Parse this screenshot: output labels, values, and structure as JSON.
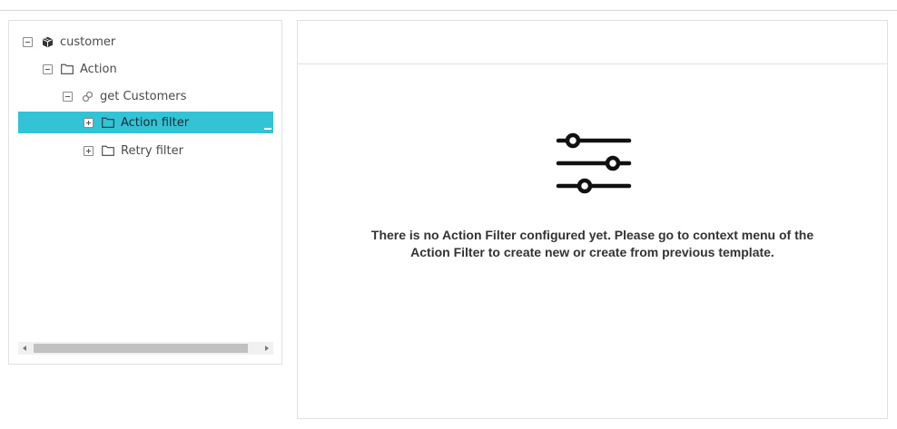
{
  "tree": {
    "nodes": [
      {
        "label": "customer",
        "icon": "cube-icon",
        "expanded": true,
        "level": 0
      },
      {
        "label": "Action",
        "icon": "folder-icon",
        "expanded": true,
        "level": 1
      },
      {
        "label": "get Customers",
        "icon": "link-icon",
        "expanded": true,
        "level": 2
      },
      {
        "label": "Action filter",
        "icon": "folder-icon",
        "expanded": false,
        "level": 3,
        "selected": true
      },
      {
        "label": "Retry filter",
        "icon": "folder-icon",
        "expanded": false,
        "level": 3
      }
    ],
    "selected_color": "#33c3d6"
  },
  "content": {
    "empty_message_line1": "There is no Action Filter configured yet. Please go to context menu of the",
    "empty_message_line2": "Action Filter to create new or create from previous template.",
    "icon": "sliders-icon"
  }
}
